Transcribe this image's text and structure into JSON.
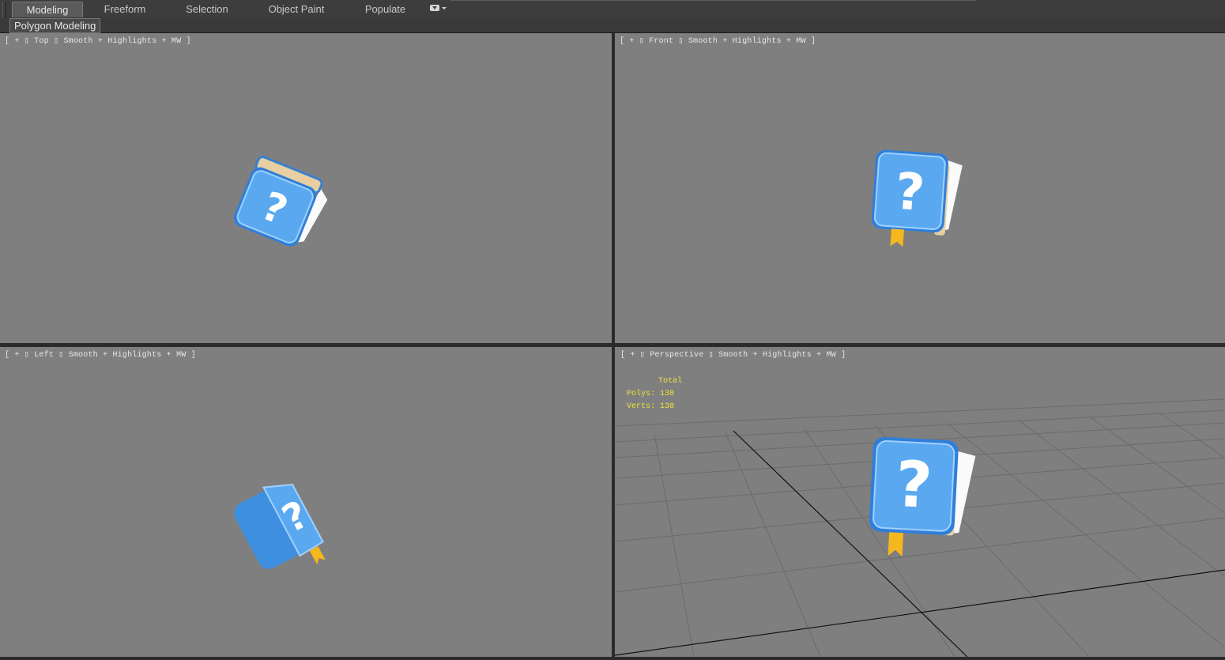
{
  "ribbon": {
    "tabs": [
      {
        "label": "Modeling",
        "active": true
      },
      {
        "label": "Freeform",
        "active": false
      },
      {
        "label": "Selection",
        "active": false
      },
      {
        "label": "Object Paint",
        "active": false
      },
      {
        "label": "Populate",
        "active": false
      }
    ],
    "dropdown_icon": "toggle-dropdown-icon"
  },
  "panel": {
    "label": "Polygon Modeling"
  },
  "viewports": {
    "top": {
      "label": "[ + ▯ Top ▯ Smooth + Highlights + MW ]"
    },
    "front": {
      "label": "[ + ▯ Front ▯ Smooth + Highlights + MW ]"
    },
    "left": {
      "label": "[ + ▯ Left ▯ Smooth + Highlights + MW ]"
    },
    "perspective": {
      "label": "[ + ▯ Perspective ▯ Smooth + Highlights + MW ]",
      "stats": {
        "total_label": "Total",
        "polys": "Polys: 138",
        "verts": "Verts: 138"
      }
    }
  },
  "colors": {
    "viewport_bg": "#7f7f7f",
    "stats_text": "#f2e23a",
    "book_cover": "#4a9be8",
    "bookmark": "#f5b71e"
  }
}
